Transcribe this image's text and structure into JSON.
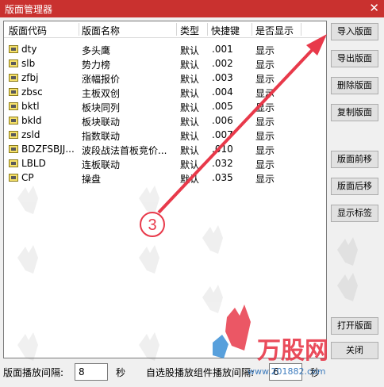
{
  "window": {
    "title": "版面管理器",
    "close_label": "✕"
  },
  "list": {
    "columns": [
      "版面代码",
      "版面名称",
      "类型",
      "快捷键",
      "是否显示"
    ],
    "rows": [
      {
        "code": "dty",
        "name": "多头鹰",
        "type": "默认",
        "key": ".001",
        "show": "显示"
      },
      {
        "code": "slb",
        "name": "势力榜",
        "type": "默认",
        "key": ".002",
        "show": "显示"
      },
      {
        "code": "zfbj",
        "name": "涨幅报价",
        "type": "默认",
        "key": ".003",
        "show": "显示"
      },
      {
        "code": "zbsc",
        "name": "主板双创",
        "type": "默认",
        "key": ".004",
        "show": "显示"
      },
      {
        "code": "bktl",
        "name": "板块同列",
        "type": "默认",
        "key": ".005",
        "show": "显示"
      },
      {
        "code": "bkld",
        "name": "板块联动",
        "type": "默认",
        "key": ".006",
        "show": "显示"
      },
      {
        "code": "zsld",
        "name": "指数联动",
        "type": "默认",
        "key": ".007",
        "show": "显示"
      },
      {
        "code": "BDZFSBJJ...",
        "name": "波段战法首板竞价...",
        "type": "默认",
        "key": ".010",
        "show": "显示"
      },
      {
        "code": "LBLD",
        "name": "连板联动",
        "type": "默认",
        "key": ".032",
        "show": "显示"
      },
      {
        "code": "CP",
        "name": "操盘",
        "type": "默认",
        "key": ".035",
        "show": "显示"
      }
    ]
  },
  "buttons": {
    "import": "导入版面",
    "export": "导出版面",
    "delete": "删除版面",
    "copy": "复制版面",
    "move_up": "版面前移",
    "move_down": "版面后移",
    "show_label": "显示标签",
    "open": "打开版面",
    "close": "关闭"
  },
  "footer": {
    "interval_label": "版面播放间隔:",
    "interval_value": "8",
    "interval_unit": "秒",
    "widget_label": "自选股播放组件播放间隔:",
    "widget_value": "6",
    "widget_unit": "秒"
  },
  "annotation": {
    "step_number": "3"
  },
  "watermark": {
    "brand": "万股网",
    "url": "www.201882.com"
  },
  "colors": {
    "titlebar": "#c9312f",
    "arrow": "#e8394a",
    "icon": "#f7e26b"
  }
}
